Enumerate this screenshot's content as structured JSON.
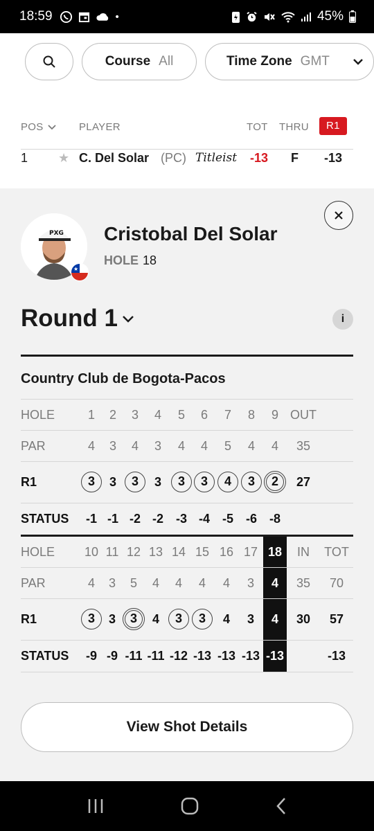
{
  "status_bar": {
    "time": "18:59",
    "battery": "45%",
    "left_icons": [
      "whatsapp-icon",
      "calendar-icon",
      "cloud-icon",
      "dot-icon"
    ],
    "right_icons": [
      "battery-saver-icon",
      "alarm-icon",
      "mute-icon",
      "wifi-icon",
      "signal-icon",
      "battery-icon"
    ]
  },
  "filters": {
    "search_icon": "search-icon",
    "course_label": "Course",
    "course_value": "All",
    "timezone_label": "Time Zone",
    "timezone_value": "GMT"
  },
  "leaderboard": {
    "headers": {
      "pos": "POS",
      "player": "PLAYER",
      "tot": "TOT",
      "thru": "THRU",
      "round": "R1"
    },
    "row": {
      "pos": "1",
      "player": "C. Del Solar",
      "tag": "(PC)",
      "brand": "Titleist",
      "tot": "-13",
      "thru": "F",
      "round": "-13"
    }
  },
  "player_card": {
    "name": "Cristobal Del Solar",
    "hole_label": "HOLE",
    "hole_value": "18",
    "country_flag": "chile-flag",
    "round_label": "Round 1",
    "course_name": "Country Club de Bogota-Pacos",
    "shot_button": "View Shot Details"
  },
  "scorecard": {
    "front": {
      "hole_label": "HOLE",
      "holes": [
        "1",
        "2",
        "3",
        "4",
        "5",
        "6",
        "7",
        "8",
        "9"
      ],
      "out_label": "OUT",
      "par_label": "PAR",
      "par": [
        "4",
        "3",
        "4",
        "3",
        "4",
        "4",
        "5",
        "4",
        "4"
      ],
      "par_out": "35",
      "round_label": "R1",
      "scores": [
        "3",
        "3",
        "3",
        "3",
        "3",
        "3",
        "4",
        "3",
        "2"
      ],
      "score_marks": [
        "circle",
        "none",
        "circle",
        "none",
        "circle",
        "circle",
        "circle",
        "circle",
        "double"
      ],
      "score_out": "27",
      "status_label": "STATUS",
      "status": [
        "-1",
        "-1",
        "-2",
        "-2",
        "-3",
        "-4",
        "-5",
        "-6",
        "-8"
      ]
    },
    "back": {
      "hole_label": "HOLE",
      "holes": [
        "10",
        "11",
        "12",
        "13",
        "14",
        "15",
        "16",
        "17",
        "18"
      ],
      "in_label": "IN",
      "tot_label": "TOT",
      "par_label": "PAR",
      "par": [
        "4",
        "3",
        "5",
        "4",
        "4",
        "4",
        "4",
        "3",
        "4"
      ],
      "par_in": "35",
      "par_tot": "70",
      "round_label": "R1",
      "scores": [
        "3",
        "3",
        "3",
        "4",
        "3",
        "3",
        "4",
        "3",
        "4"
      ],
      "score_marks": [
        "circle",
        "none",
        "double",
        "none",
        "circle",
        "circle",
        "none",
        "none",
        "none"
      ],
      "score_in": "30",
      "score_tot": "57",
      "status_label": "STATUS",
      "status": [
        "-9",
        "-9",
        "-11",
        "-11",
        "-12",
        "-13",
        "-13",
        "-13",
        "-13"
      ],
      "status_tot": "-13",
      "current_hole_index": 8
    }
  },
  "nav_bar": {
    "icons": [
      "recent-apps-icon",
      "home-icon",
      "back-icon"
    ]
  },
  "colors": {
    "accent_red": "#d71920",
    "score_red": "#d71920"
  }
}
